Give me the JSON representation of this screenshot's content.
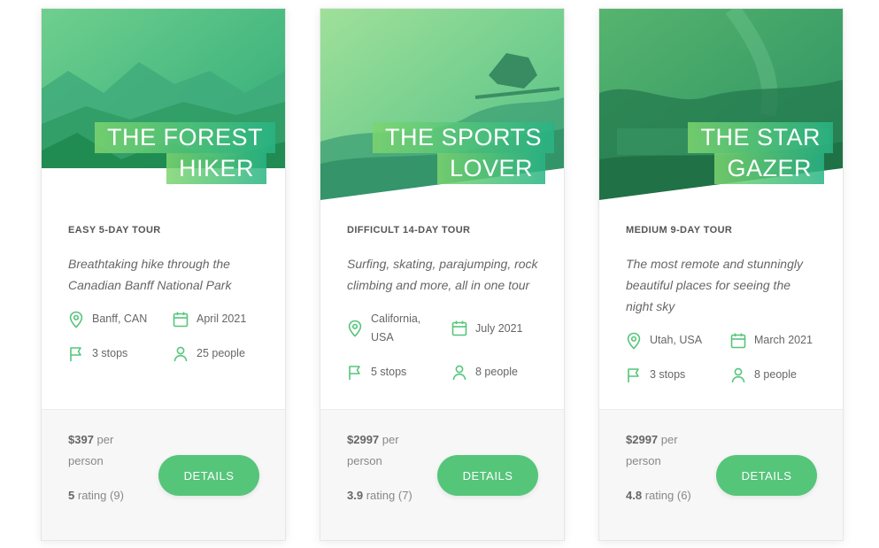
{
  "colors": {
    "accent": "#55c57a",
    "accent_dark": "#28b485"
  },
  "cards": [
    {
      "title_line1": "The Forest",
      "title_line2": "Hiker",
      "label": "Easy 5-day tour",
      "description": "Breathtaking hike through the Canadian Banff National Park",
      "location": "Banff, CAN",
      "date": "April 2021",
      "stops": "3 stops",
      "people": "25 people",
      "price_amount": "$397",
      "price_unit": "per person",
      "rating_value": "5",
      "rating_word": "rating",
      "rating_count": "(9)",
      "button": "Details",
      "icons": [
        "map-pin-icon",
        "calendar-icon",
        "flag-icon",
        "user-icon"
      ]
    },
    {
      "title_line1": "The Sports",
      "title_line2": "Lover",
      "label": "Difficult 14-day tour",
      "description": "Surfing, skating, parajumping, rock climbing and more, all in one tour",
      "location": "California, USA",
      "date": "July 2021",
      "stops": "5 stops",
      "people": "8 people",
      "price_amount": "$2997",
      "price_unit": "per person",
      "rating_value": "3.9",
      "rating_word": "rating",
      "rating_count": "(7)",
      "button": "Details",
      "icons": [
        "map-pin-icon",
        "calendar-icon",
        "flag-icon",
        "user-icon"
      ]
    },
    {
      "title_line1": "The Star",
      "title_line2": "Gazer",
      "label": "Medium 9-day tour",
      "description": "The most remote and stunningly beautiful places for seeing the night sky",
      "location": "Utah, USA",
      "date": "March 2021",
      "stops": "3 stops",
      "people": "8 people",
      "price_amount": "$2997",
      "price_unit": "per person",
      "rating_value": "4.8",
      "rating_word": "rating",
      "rating_count": "(6)",
      "button": "Details",
      "icons": [
        "map-pin-icon",
        "calendar-icon",
        "flag-icon",
        "user-icon"
      ]
    }
  ]
}
